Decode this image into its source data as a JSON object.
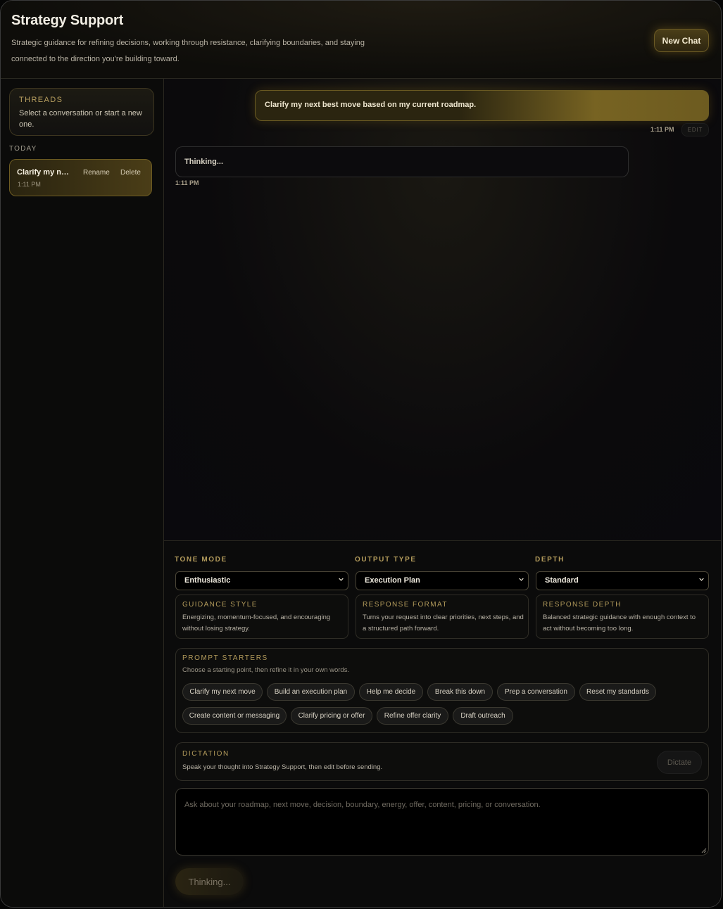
{
  "header": {
    "title": "Strategy Support",
    "subtitle": "Strategic guidance for refining decisions, working through resistance, clarifying boundaries, and staying connected to the direction you're building toward.",
    "new_chat_label": "New Chat"
  },
  "sidebar": {
    "threads_heading": "THREADS",
    "threads_description": "Select a conversation or start a new one.",
    "section_today": "TODAY",
    "items": [
      {
        "title": "Clarify my next best move based on my current roadmap.",
        "time": "1:11 PM",
        "rename_label": "Rename",
        "delete_label": "Delete"
      }
    ]
  },
  "messages": [
    {
      "role": "user",
      "text": "Clarify my next best move based on my current roadmap.",
      "time": "1:11 PM",
      "edit_label": "EDIT"
    },
    {
      "role": "assistant",
      "text": "Thinking...",
      "time": "1:11 PM"
    }
  ],
  "controls": {
    "tone": {
      "label": "TONE MODE",
      "value": "Enthusiastic"
    },
    "output": {
      "label": "OUTPUT TYPE",
      "value": "Execution Plan"
    },
    "depth": {
      "label": "DEPTH",
      "value": "Standard"
    },
    "cards": [
      {
        "heading": "GUIDANCE STYLE",
        "body": "Energizing, momentum-focused, and encouraging without losing strategy."
      },
      {
        "heading": "RESPONSE FORMAT",
        "body": "Turns your request into clear priorities, next steps, and a structured path forward."
      },
      {
        "heading": "RESPONSE DEPTH",
        "body": "Balanced strategic guidance with enough context to act without becoming too long."
      }
    ]
  },
  "starters": {
    "heading": "PROMPT STARTERS",
    "description": "Choose a starting point, then refine it in your own words.",
    "chips": [
      "Clarify my next move",
      "Build an execution plan",
      "Help me decide",
      "Break this down",
      "Prep a conversation",
      "Reset my standards",
      "Create content or messaging",
      "Clarify pricing or offer",
      "Refine offer clarity",
      "Draft outreach"
    ]
  },
  "dictation": {
    "heading": "DICTATION",
    "description": "Speak your thought into Strategy Support, then edit before sending.",
    "button_label": "Dictate"
  },
  "composer": {
    "placeholder": "Ask about your roadmap, next move, decision, boundary, energy, offer, content, pricing, or conversation.",
    "send_label": "Thinking..."
  },
  "colors": {
    "accent_gold": "#b49c5c",
    "bubble_gold": "#776322",
    "background": "#0a0a0a"
  }
}
